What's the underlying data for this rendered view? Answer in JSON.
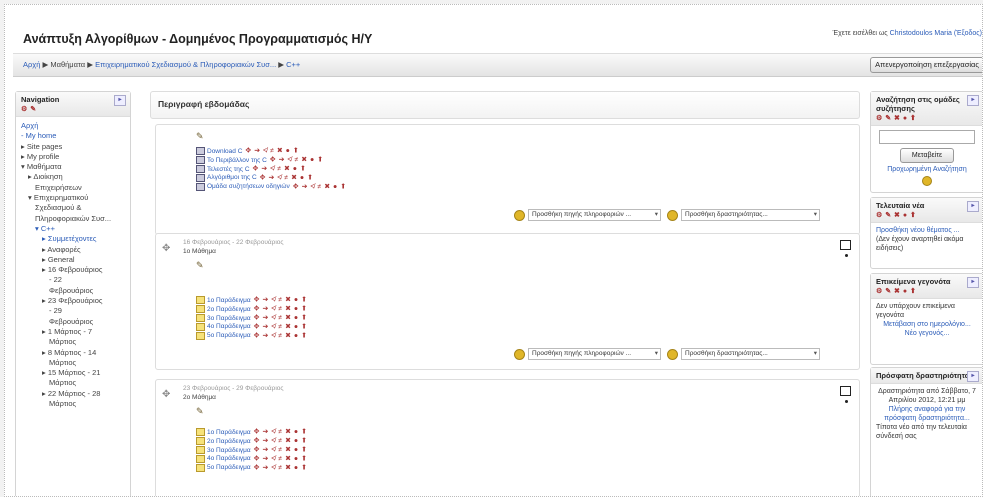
{
  "header": {
    "site_title": "Ανάπτυξη Αλγορίθμων - Δομημένος Προγραμματισμός Η/Υ",
    "login_text": "Έχετε εισέλθει ως",
    "login_user": "Christodoulos Maria (Έξοδος)"
  },
  "breadcrumb": {
    "items": [
      "Αρχή",
      "Μαθήματα",
      "Επιχειρηματικού Σχεδιασμού & Πληροφοριακών Συσ...",
      "C++"
    ],
    "separator": "▶"
  },
  "edit_button": "Απενεργοποίηση επεξεργασίας",
  "navigation": {
    "title": "Navigation",
    "items": [
      {
        "text": "Αρχή",
        "style": "lnk",
        "indent": 0
      },
      {
        "text": "- My home",
        "style": "lnk",
        "indent": 0
      },
      {
        "text": "▸ Site pages",
        "style": "gr",
        "indent": 0
      },
      {
        "text": "▸ My profile",
        "style": "gr",
        "indent": 0
      },
      {
        "text": "▾ Μαθήματα",
        "style": "gr",
        "indent": 0
      },
      {
        "text": "▸ Διοίκηση",
        "style": "gr",
        "indent": 1
      },
      {
        "text": "Επιχειρήσεων",
        "style": "gr",
        "indent": 2
      },
      {
        "text": "▾ Επιχειρηματικού",
        "style": "gr",
        "indent": 1
      },
      {
        "text": "Σχεδιασμού &",
        "style": "gr",
        "indent": 2
      },
      {
        "text": "Πληροφοριακών Συσ...",
        "style": "gr",
        "indent": 2
      },
      {
        "text": "▾ C++",
        "style": "lnk",
        "indent": 2
      },
      {
        "text": "▸ Συμμετέχοντες",
        "style": "lnk",
        "indent": 3
      },
      {
        "text": "▸ Αναφορές",
        "style": "gr",
        "indent": 3
      },
      {
        "text": "▸ General",
        "style": "gr",
        "indent": 3
      },
      {
        "text": "▸ 16 Φεβρουάριος",
        "style": "gr",
        "indent": 3
      },
      {
        "text": "- 22",
        "style": "gr",
        "indent": 4
      },
      {
        "text": "Φεβρουάριος",
        "style": "gr",
        "indent": 4
      },
      {
        "text": "▸ 23 Φεβρουάριος",
        "style": "gr",
        "indent": 3
      },
      {
        "text": "- 29",
        "style": "gr",
        "indent": 4
      },
      {
        "text": "Φεβρουάριος",
        "style": "gr",
        "indent": 4
      },
      {
        "text": "▸ 1 Μάρτιος - 7",
        "style": "gr",
        "indent": 3
      },
      {
        "text": "Μάρτιος",
        "style": "gr",
        "indent": 4
      },
      {
        "text": "▸ 8 Μάρτιος - 14",
        "style": "gr",
        "indent": 3
      },
      {
        "text": "Μάρτιος",
        "style": "gr",
        "indent": 4
      },
      {
        "text": "▸ 15 Μάρτιος - 21",
        "style": "gr",
        "indent": 3
      },
      {
        "text": "Μάρτιος",
        "style": "gr",
        "indent": 4
      },
      {
        "text": "▸ 22 Μάρτιος - 28",
        "style": "gr",
        "indent": 3
      },
      {
        "text": "Μάρτιος",
        "style": "gr",
        "indent": 4
      }
    ]
  },
  "main": {
    "heading": "Περιγραφή εβδομάδας",
    "add_resource": "Προσθήκη πηγής πληροφοριών ...",
    "add_activity": "Προσθήκη δραστηριότητας...",
    "summary_items": [
      {
        "label": "Download C",
        "type": "doc"
      },
      {
        "label": "Το Περιβάλλον της C",
        "type": "doc"
      },
      {
        "label": "Τελεστές της C",
        "type": "doc"
      },
      {
        "label": "Αλγόριθμοι της C",
        "type": "doc"
      },
      {
        "label": "Ομάδα συζητήσεων οδηγιών",
        "type": "forum"
      }
    ],
    "week1": {
      "date": "16 Φεβρουάριος - 22 Φεβρουάριος",
      "title": "1ο Μάθημα",
      "items": [
        "1ο Παράδειγμα",
        "2ο Παράδειγμα",
        "3ο Παράδειγμα",
        "4ο Παράδειγμα",
        "5ο Παράδειγμα"
      ]
    },
    "week2": {
      "date": "23 Φεβρουάριος - 29 Φεβρουάριος",
      "title": "2ο Μάθημα",
      "items": [
        "1ο Παράδειγμα",
        "2ο Παράδειγμα",
        "3ο Παράδειγμα",
        "4ο Παράδειγμα",
        "5ο Παράδειγμα"
      ]
    },
    "edit_icons": "✥ ➔ ≮ ≠ ✖ ● ⬆"
  },
  "right": {
    "search": {
      "title": "Αναζήτηση στις ομάδες συζήτησης",
      "button": "Μεταβείτε",
      "advanced": "Προχωρημένη Αναζήτηση"
    },
    "news": {
      "title": "Τελευταία νέα",
      "add": "Προσθήκη νέου θέματος ...",
      "empty": "(Δεν έχουν αναρτηθεί ακόμα ειδήσεις)"
    },
    "upcoming": {
      "title": "Επικείμενα γεγονότα",
      "empty": "Δεν υπάρχουν επικείμενα γεγονότα",
      "goto": "Μετάβαση στο ημερολόγιο...",
      "new": "Νέο γεγονός..."
    },
    "recent": {
      "title": "Πρόσφατη δραστηριότητα",
      "since": "Δραστηριότητα από Σάββατο, 7 Απριλίου 2012, 12:21 μμ",
      "full": "Πλήρης αναφορά για την πρόσφατη δραστηριότητα...",
      "none": "Τίποτα νέο από την τελευταία σύνδεσή σας"
    },
    "block_icons": "⚙ ✎ ✖ ● ⬆"
  }
}
